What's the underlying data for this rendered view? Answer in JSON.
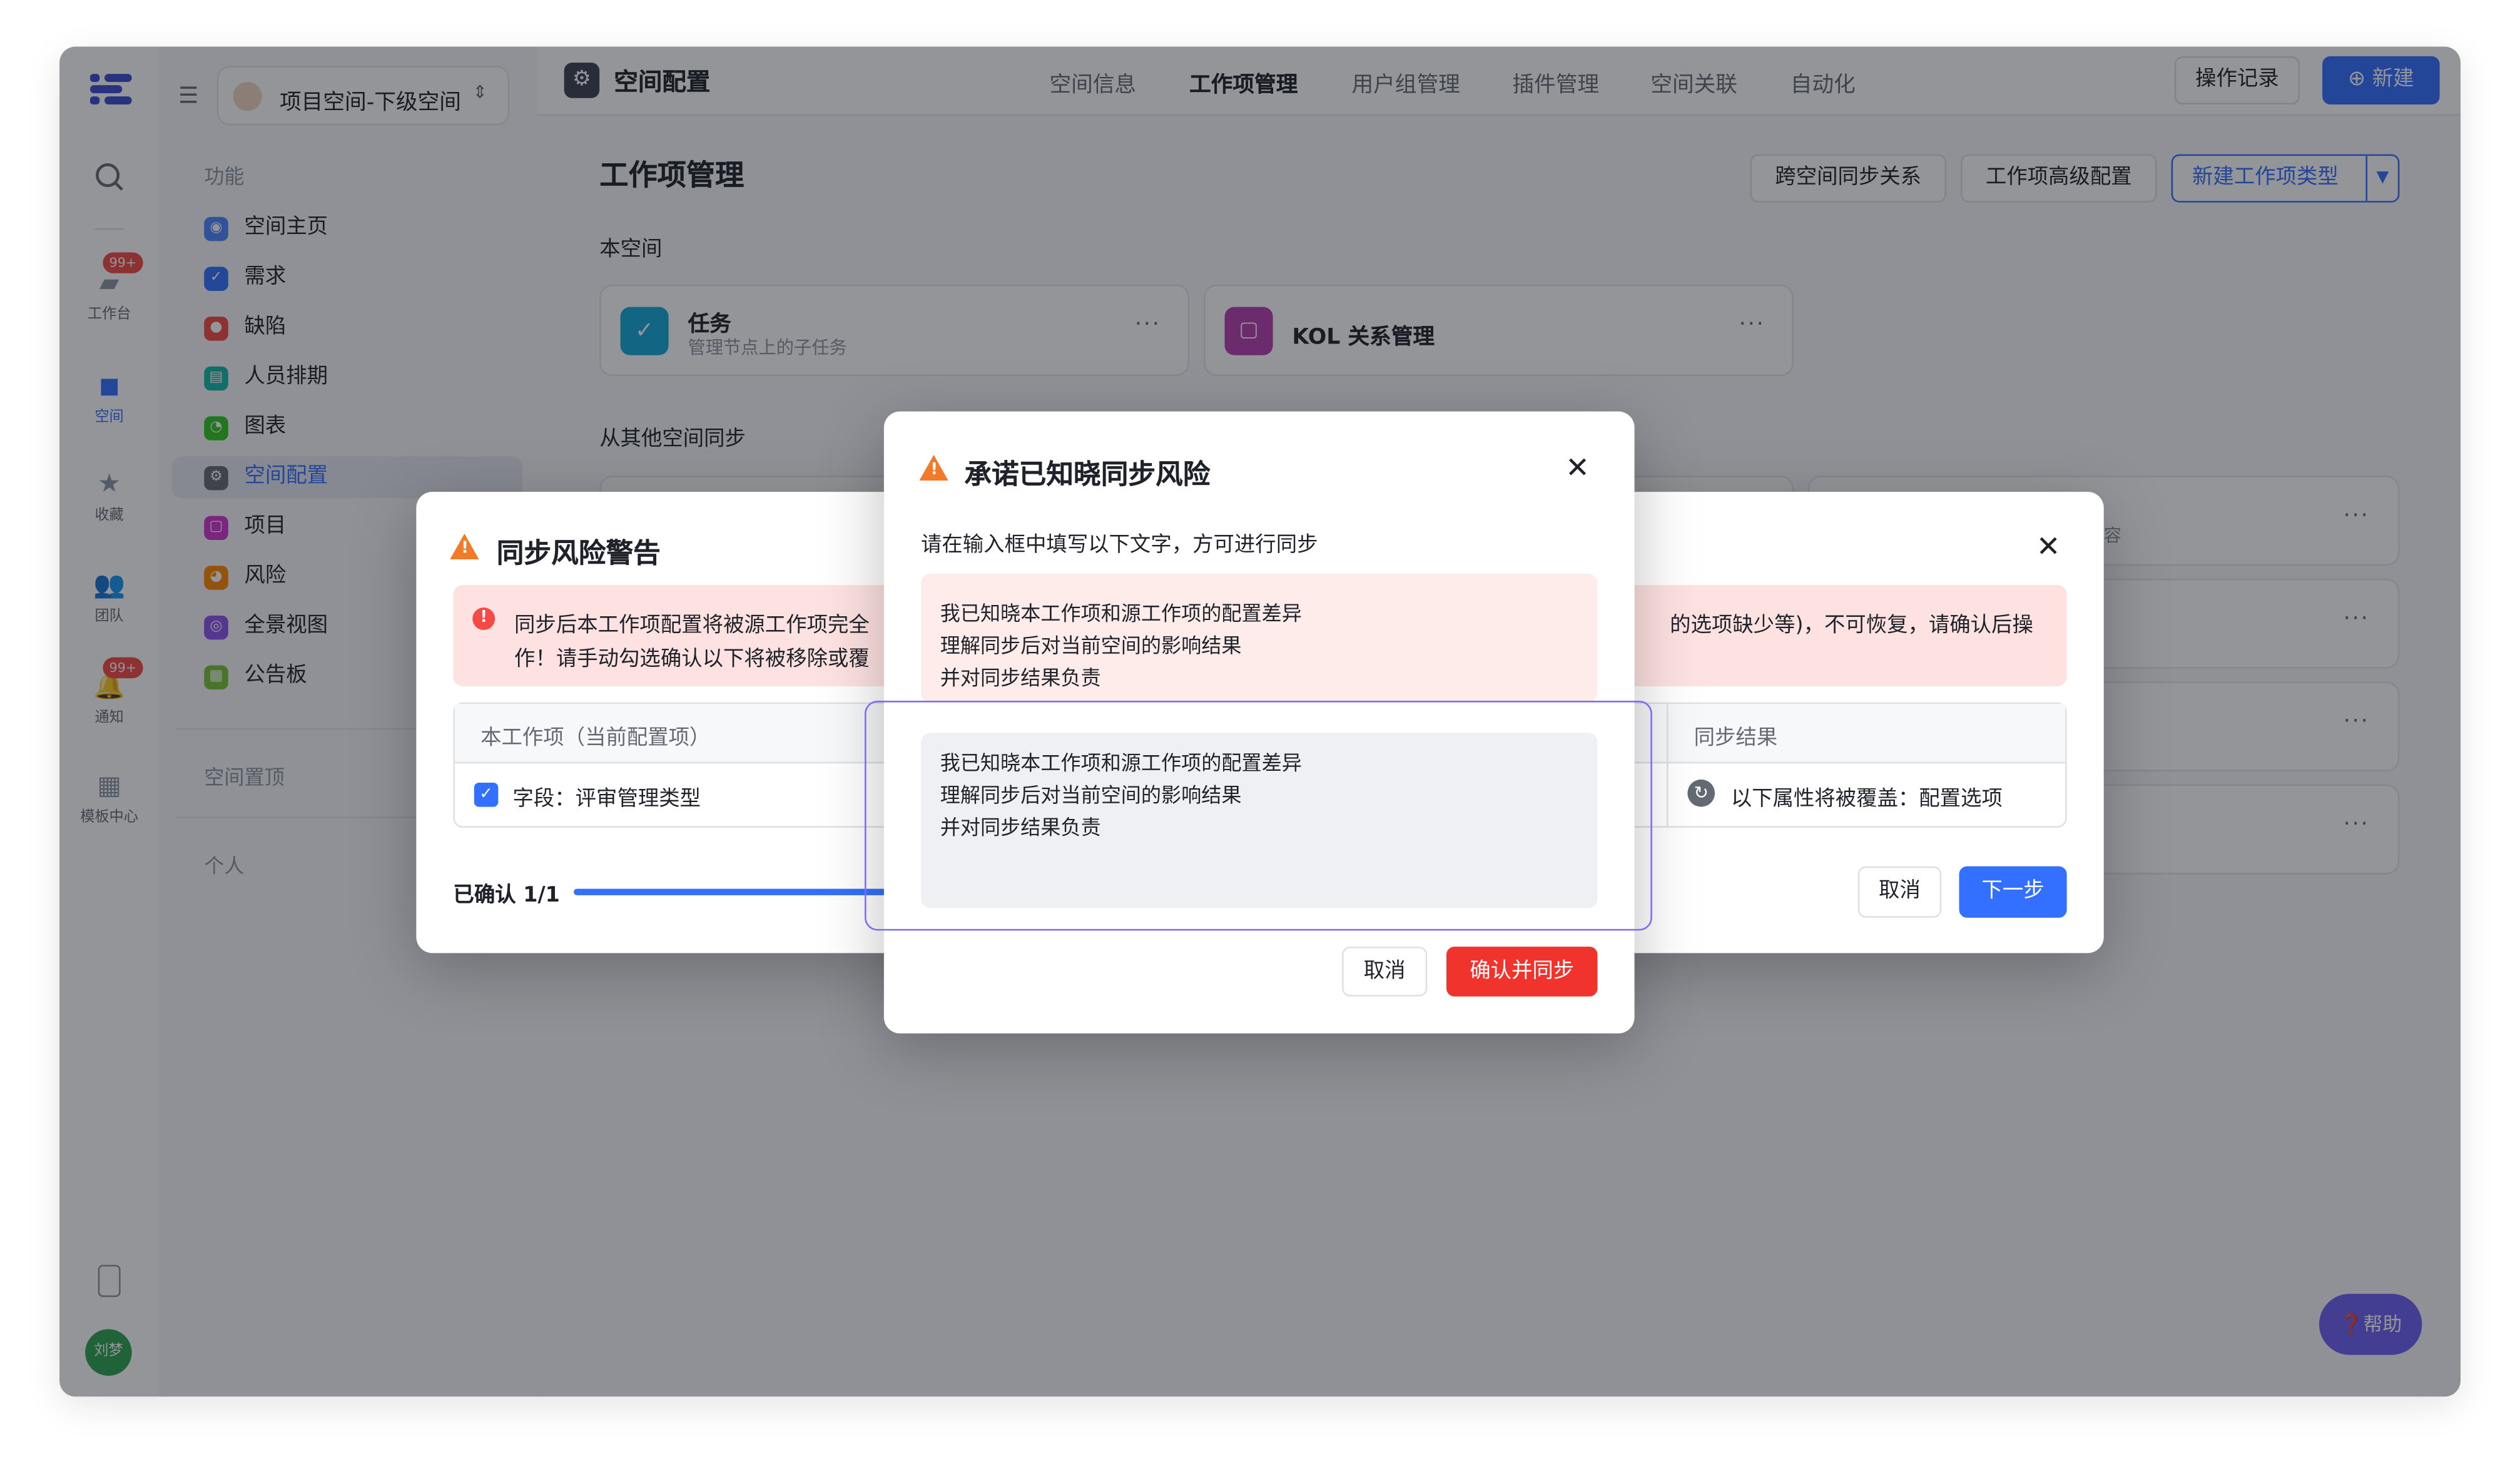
{
  "rail": {
    "workbench_label": "工作台",
    "workbench_badge": "99+",
    "space_label": "空间",
    "favorites_label": "收藏",
    "team_label": "团队",
    "notify_label": "通知",
    "notify_badge": "99+",
    "templates_label": "模板中心",
    "avatar_text": "刘梦"
  },
  "sidebar": {
    "space_selector": "项目空间-下级空间",
    "section_features": "功能",
    "items": [
      {
        "label": "空间主页",
        "color": "#4e83fd"
      },
      {
        "label": "需求",
        "color": "#3370ff"
      },
      {
        "label": "缺陷",
        "color": "#f54a45"
      },
      {
        "label": "人员排期",
        "color": "#14b8a6"
      },
      {
        "label": "图表",
        "color": "#34c724"
      },
      {
        "label": "空间配置",
        "color": "#646a73"
      },
      {
        "label": "项目",
        "color": "#d136d1"
      },
      {
        "label": "风险",
        "color": "#ff8800"
      },
      {
        "label": "全景视图",
        "color": "#8d55ed"
      },
      {
        "label": "公告板",
        "color": "#7bc335"
      }
    ],
    "section_pinned": "空间置顶",
    "section_personal": "个人"
  },
  "topbar": {
    "title": "空间配置",
    "tabs": [
      "空间信息",
      "工作项管理",
      "用户组管理",
      "插件管理",
      "空间关联",
      "自动化"
    ],
    "active_tab": "工作项管理",
    "log_button": "操作记录",
    "new_button": "新建"
  },
  "content": {
    "heading": "工作项管理",
    "cross_sync_button": "跨空间同步关系",
    "advanced_button": "工作项高级配置",
    "new_type_button": "新建工作项类型",
    "this_space_label": "本空间",
    "task_card": {
      "title": "任务",
      "subtitle": "管理节点上的子任务"
    },
    "kol_card": {
      "title": "KOL 关系管理"
    },
    "other_space_label": "从其他空间同步",
    "partial_text": "容"
  },
  "warn_dialog": {
    "title": "同步风险警告",
    "alert_line1_left": "同步后本工作项配置将被源工作项完全",
    "alert_line1_right": "的选项缺少等)，不可恢复，请确认后操",
    "alert_line2": "作！请手动勾选确认以下将被移除或覆",
    "col_local": "本工作项（当前配置项）",
    "col_result": "同步结果",
    "row_field": "字段：评审管理类型",
    "row_result": "以下属性将被覆盖：配置选项",
    "progress_label": "已确认 1/1",
    "progress_value": 1.0,
    "cancel": "取消",
    "next": "下一步"
  },
  "confirm_dialog": {
    "title": "承诺已知晓同步风险",
    "instruction": "请在输入框中填写以下文字，方可进行同步",
    "required_lines": [
      "我已知晓本工作项和源工作项的配置差异",
      "理解同步后对当前空间的影响结果",
      "并对同步结果负责"
    ],
    "input_lines": [
      "我已知晓本工作项和源工作项的配置差异",
      "理解同步后对当前空间的影响结果",
      "并对同步结果负责"
    ],
    "cancel": "取消",
    "confirm": "确认并同步"
  },
  "help_button": "帮助"
}
